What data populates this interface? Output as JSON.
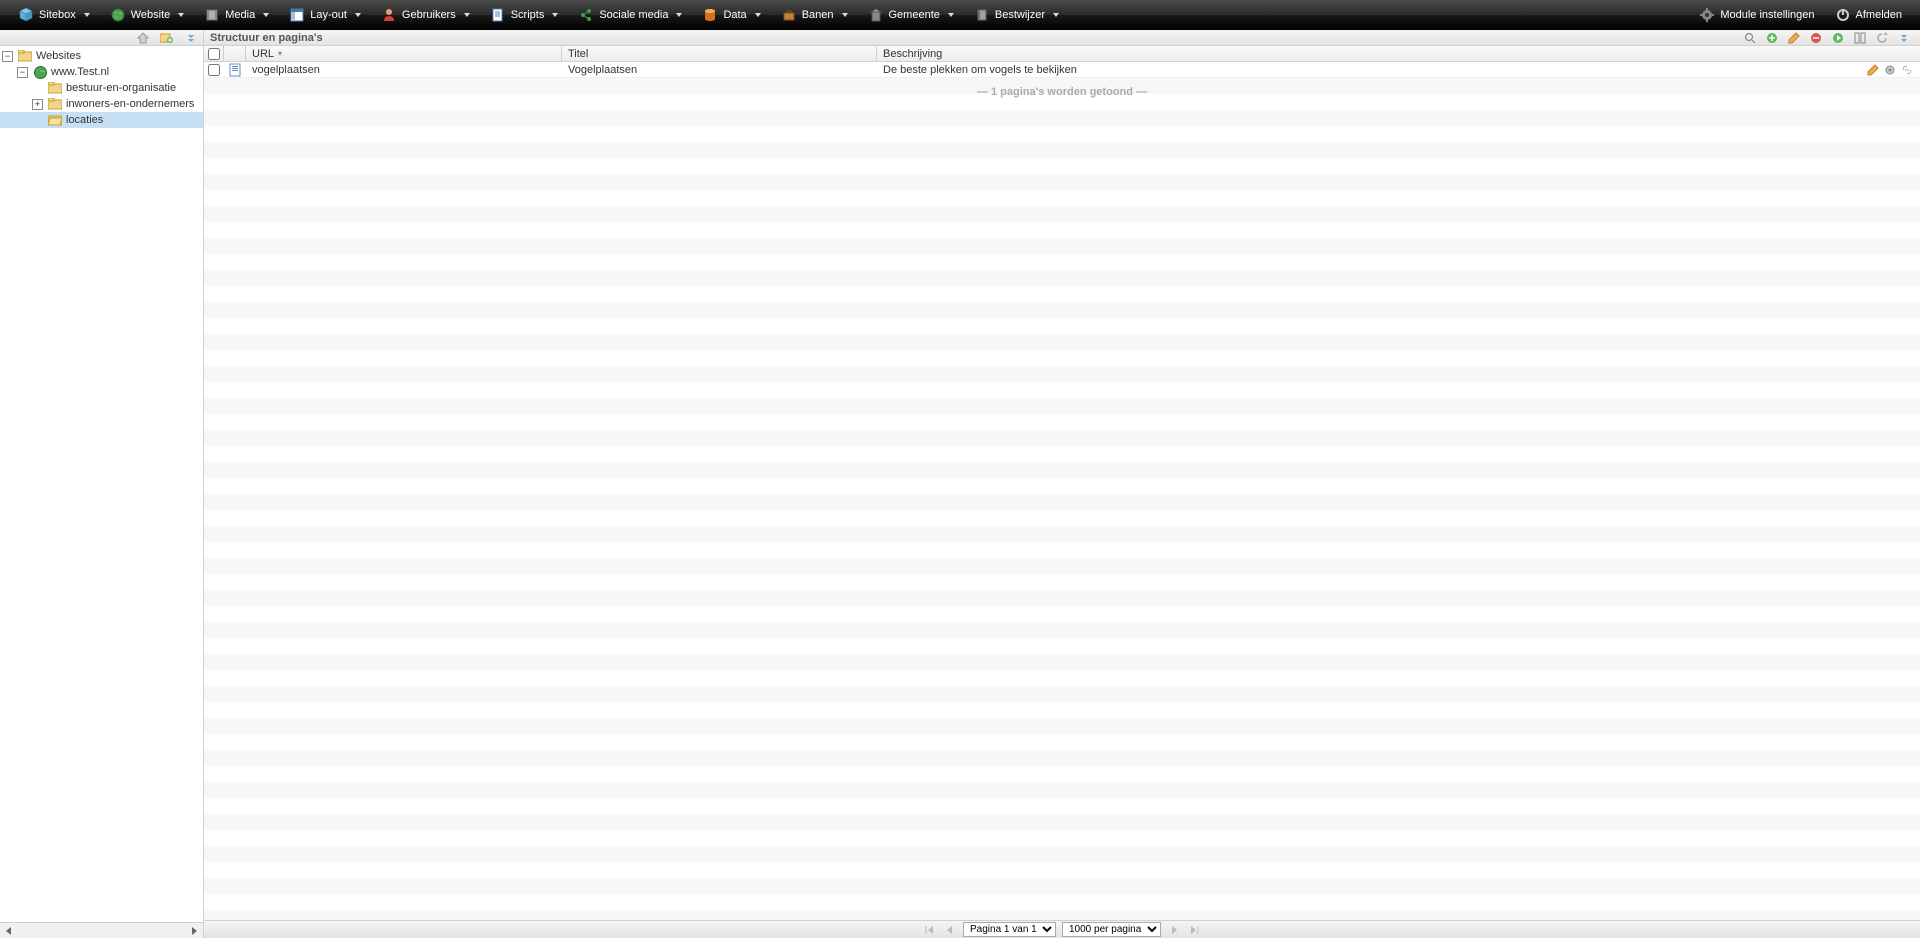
{
  "topmenu": {
    "items": [
      {
        "label": "Sitebox",
        "icon": "cube"
      },
      {
        "label": "Website",
        "icon": "globe"
      },
      {
        "label": "Media",
        "icon": "film"
      },
      {
        "label": "Lay-out",
        "icon": "layout"
      },
      {
        "label": "Gebruikers",
        "icon": "user"
      },
      {
        "label": "Scripts",
        "icon": "script"
      },
      {
        "label": "Sociale media",
        "icon": "share"
      },
      {
        "label": "Data",
        "icon": "database"
      },
      {
        "label": "Banen",
        "icon": "briefcase"
      },
      {
        "label": "Gemeente",
        "icon": "building"
      },
      {
        "label": "Bestwijzer",
        "icon": "book"
      }
    ],
    "right": [
      {
        "label": "Module instellingen",
        "icon": "gear",
        "name": "module-settings"
      },
      {
        "label": "Afmelden",
        "icon": "power",
        "name": "logout"
      }
    ]
  },
  "sidebar": {
    "tree": {
      "root": "Websites",
      "site": "www.Test.nl",
      "nodes": [
        {
          "label": "bestuur-en-organisatie",
          "expandable": false
        },
        {
          "label": "inwoners-en-ondernemers",
          "expandable": true
        },
        {
          "label": "locaties",
          "expandable": false,
          "selected": true
        }
      ]
    }
  },
  "main": {
    "title": "Structuur en pagina's",
    "columns": {
      "url": "URL",
      "title": "Titel",
      "desc": "Beschrijving"
    },
    "rows": [
      {
        "url": "vogelplaatsen",
        "title": "Vogelplaatsen",
        "desc": "De beste plekken om vogels te bekijken"
      }
    ],
    "summary": "— 1 pagina's worden getoond —"
  },
  "pager": {
    "page": "Pagina 1 van 1",
    "perpage": "1000 per pagina"
  }
}
